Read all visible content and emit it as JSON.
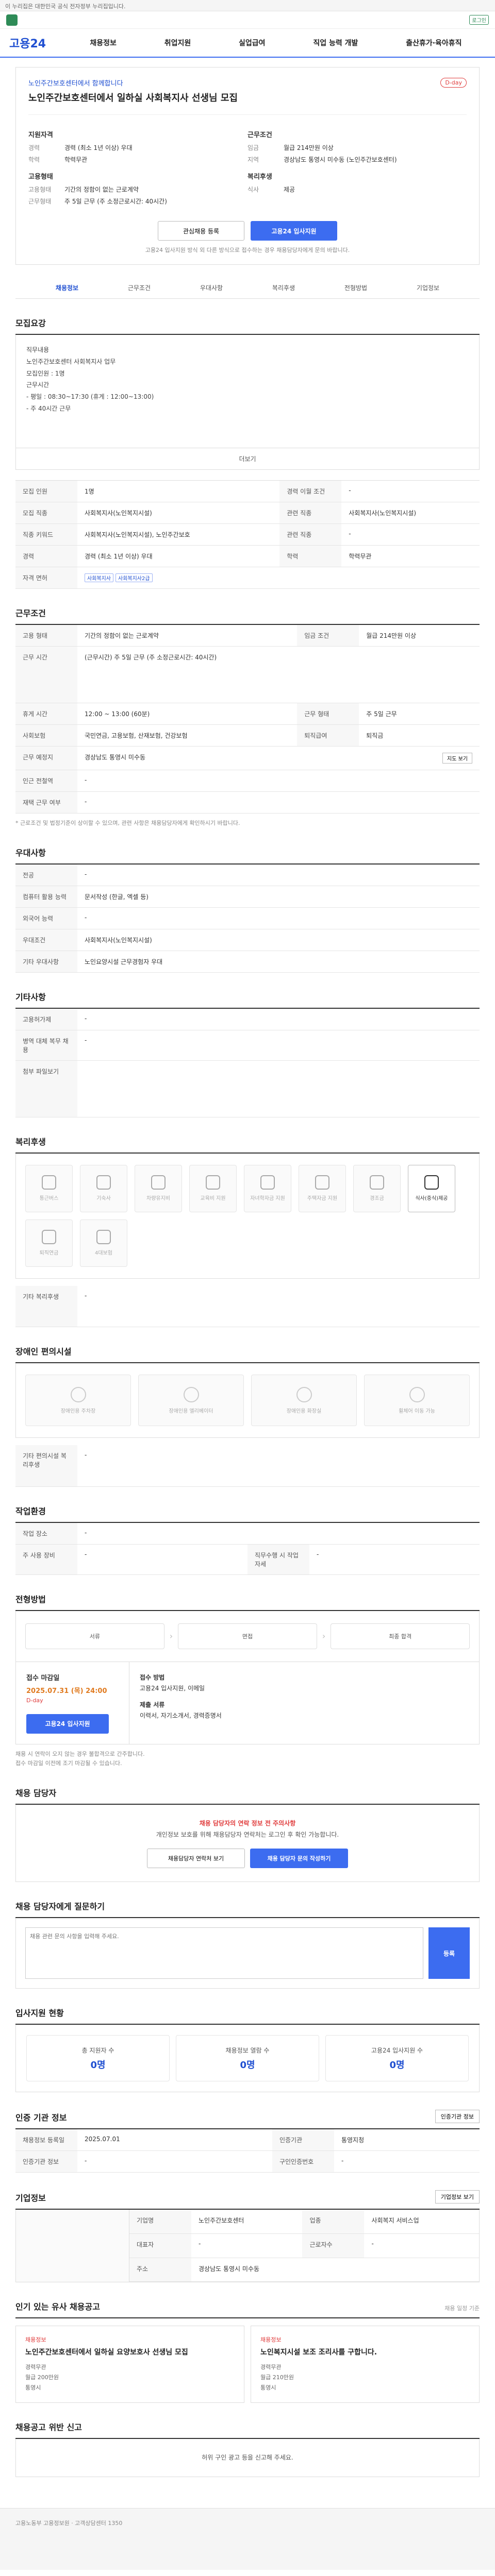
{
  "topbar": {
    "text": "이 누리집은 대한민국 공식 전자정부 누리집입니다."
  },
  "site": {
    "logo": "고용24",
    "badge": "로그인"
  },
  "gnb": [
    "채용정보",
    "취업지원",
    "실업급여",
    "직업 능력 개발",
    "출산휴가·육아휴직"
  ],
  "lnb": [
    "채용정보",
    "근무조건",
    "우대사항",
    "복리후생",
    "전형방법",
    "기업정보"
  ],
  "job": {
    "company": "노인주간보호센터에서 함께합니다",
    "title": "노인주간보호센터에서 일하실 사회복지사 선생님 모집",
    "dday": "D-day",
    "left_head": "지원자격",
    "left_rows": [
      {
        "k": "경력",
        "v": "경력 (최소 1년 이상) 우대"
      },
      {
        "k": "학력",
        "v": "학력무관"
      }
    ],
    "left_head2": "고용형태",
    "left_rows2": [
      {
        "k": "고용형태",
        "v": "기간의 정함이 없는 근로계약"
      },
      {
        "k": "근무형태",
        "v": "주 5일 근무 (주 소정근로시간: 40시간)"
      }
    ],
    "right_head": "근무조건",
    "right_rows": [
      {
        "k": "임금",
        "v": "월급 214만원 이상"
      },
      {
        "k": "지역",
        "v": "경상남도 통영시 미수동 (노인주간보호센터)"
      }
    ],
    "right_head2": "복리후생",
    "right_rows2": [
      {
        "k": "식사",
        "v": "제공"
      }
    ],
    "btn_scrap": "관심채용 등록",
    "btn_apply": "고용24 입사지원",
    "apply_note": "고용24 입사지원 방식 외 다른 방식으로 접수하는 경우 채용담당자에게 문의 바랍니다."
  },
  "recruit": {
    "title": "모집요강",
    "lines": [
      "직무내용",
      "노인주간보호센터 사회복지사 업무",
      "",
      "모집인원 : 1명",
      "",
      "근무시간",
      "- 평일 : 08:30~17:30 (휴게 : 12:00~13:00)",
      "- 주 40시간 근무"
    ],
    "more": "더보기"
  },
  "summary": {
    "rows": [
      {
        "k": "모집 인원",
        "v": "1명",
        "k2": "경력 이월 조건",
        "v2": "-"
      },
      {
        "k": "모집 직종",
        "v": "사회복지사(노인복지시설)",
        "k2": "관련 직종",
        "v2": "사회복지사(노인복지시설)"
      },
      {
        "k": "직종 키워드",
        "v": "사회복지사(노인복지시설), 노인주간보호",
        "k2": "관련 직종",
        "v2": "-"
      },
      {
        "k": "경력",
        "v": "경력 (최소 1년 이상) 우대",
        "k2": "학력",
        "v2": "학력무관"
      }
    ],
    "tags_label": "자격 면허",
    "tags": [
      "사회복지사",
      "사회복지사2급"
    ]
  },
  "conditions": {
    "title": "근무조건",
    "rows": [
      {
        "k": "고용 형태",
        "v": "기간의 정함이 없는 근로계약",
        "k2": "임금 조건",
        "v2": "월급 214만원 이상"
      },
      {
        "k": "근무 시간",
        "v": "(근무시간) 주 5일 근무 (주 소정근로시간: 40시간)",
        "k2": "",
        "v2": ""
      },
      {
        "k": "휴게 시간",
        "v": "12:00 ~ 13:00 (60분)",
        "k2": "근무 형태",
        "v2": "주 5일 근무"
      },
      {
        "k": "사회보험",
        "v": "국민연금, 고용보험, 산재보험, 건강보험",
        "k2": "퇴직급여",
        "v2": "퇴직금"
      },
      {
        "k": "근무 예정지",
        "v": "경상남도 통영시 미수동",
        "k2": "",
        "v2": ""
      },
      {
        "k": "인근 전철역",
        "v": "-",
        "k2": "",
        "v2": ""
      },
      {
        "k": "재택 근무 여부",
        "v": "-",
        "k2": "",
        "v2": ""
      }
    ],
    "map_btn": "지도 보기",
    "note": "* 근로조건 및 법정기준이 상이할 수 있으며, 관련 사항은 채용담당자에게 확인하시기 바랍니다."
  },
  "prefer": {
    "title": "우대사항",
    "rows": [
      {
        "k": "전공",
        "v": "-"
      },
      {
        "k": "컴퓨터 활용 능력",
        "v": "문서작성 (한글, 엑셀 등)"
      },
      {
        "k": "외국어 능력",
        "v": "-"
      },
      {
        "k": "우대조건",
        "v": "사회복지사(노인복지시설)"
      },
      {
        "k": "기타 우대사항",
        "v": "노인요양시설 근무경험자 우대"
      }
    ]
  },
  "etc": {
    "title": "기타사항",
    "rows": [
      {
        "k": "고용허가제",
        "v": "-"
      },
      {
        "k": "병역 대체 복무 채용",
        "v": "-"
      }
    ],
    "file_label": "첨부 파일보기"
  },
  "welfare": {
    "title": "복리후생",
    "items": [
      "통근버스",
      "기숙사",
      "차량유지비",
      "교육비 지원",
      "자녀학자금 지원",
      "주택자금 지원",
      "경조금",
      "식사(중식)제공",
      "퇴직연금",
      "4대보험"
    ],
    "etc_label": "기타 복리후생",
    "etc_value": "-"
  },
  "disabled": {
    "title": "장애인 편의시설",
    "items": [
      "장애인용 주차장",
      "장애인용 엘리베이터",
      "장애인용 화장실",
      "휠체어 이동 가능"
    ],
    "etc_label": "기타 편의시설 복리후생",
    "etc_value": "-"
  },
  "worktype": {
    "title": "작업환경",
    "rows": [
      {
        "k": "작업 장소",
        "v": "-",
        "k2": "",
        "v2": ""
      },
      {
        "k": "주 사용 장비",
        "v": "-",
        "k2": "직무수행 시 작업 자세",
        "v2": "-"
      }
    ]
  },
  "process": {
    "title": "전형방법",
    "steps": [
      "서류",
      "면접",
      "최종 합격"
    ]
  },
  "schedule": {
    "title": "접수 마감일",
    "date": "2025.07.31 (목) 24:00",
    "dday": "D-day",
    "method_title": "접수 방법",
    "method": "고용24 입사지원, 이메일",
    "docs_title": "제출 서류",
    "docs": "이력서, 자기소개서, 경력증명서",
    "apply_btn": "고용24 입사지원",
    "notes": [
      "채용 시 연락이 오지 않는 경우 불합격으로 간주합니다.",
      "접수 마감일 이전에 조기 마감될 수 있습니다."
    ]
  },
  "contact": {
    "title": "채용 담당자",
    "warn": "채용 담당자의 연락 정보 전 주의사항",
    "desc": "개인정보 보호를 위해 채용담당자 연락처는 로그인 후 확인 가능합니다.",
    "btn1": "채용담당자 연락처 보기",
    "btn2": "채용 담당자 문의 작성하기"
  },
  "qa": {
    "title": "채용 담당자에게 질문하기",
    "placeholder": "채용 관련 문의 사항을 입력해 주세요.",
    "btn": "등록"
  },
  "stats": {
    "title": "입사지원 현황",
    "cards": [
      {
        "k": "총 지원자 수",
        "v": "0명"
      },
      {
        "k": "채용정보 열람 수",
        "v": "0명"
      },
      {
        "k": "고용24 입사지원 수",
        "v": "0명"
      }
    ]
  },
  "info": {
    "title": "인증 기관 정보",
    "rows": [
      {
        "k": "채용정보 등록일",
        "v": "2025.07.01",
        "k2": "인증기관",
        "v2": "통영지청"
      },
      {
        "k": "인증기관 정보",
        "v": "-",
        "k2": "구인인증번호",
        "v2": "-"
      }
    ],
    "btn": "인증기관 정보"
  },
  "company": {
    "title": "기업정보",
    "rows": [
      {
        "k": "기업명",
        "v": "노인주간보호센터",
        "k2": "업종",
        "v2": "사회복지 서비스업"
      },
      {
        "k": "대표자",
        "v": "-",
        "k2": "근로자수",
        "v2": "-"
      },
      {
        "k": "주소",
        "v": "경상남도 통영시 미수동",
        "k2": "",
        "v2": ""
      }
    ],
    "btn": "기업정보 보기"
  },
  "others": {
    "title": "인기 있는 유사 채용공고",
    "sub": "채용 일정 기준",
    "cards": [
      {
        "co": "채용정보",
        "ti": "노인주간보호센터에서 일하실 요양보호사 선생님 모집",
        "lines": [
          "경력무관",
          "월급 200만원",
          "통영시"
        ]
      },
      {
        "co": "채용정보",
        "ti": "노인복지시설 보조 조리사를 구합니다.",
        "lines": [
          "경력무관",
          "월급 210만원",
          "통영시"
        ]
      }
    ]
  },
  "help": {
    "title": "채용공고 위반 신고",
    "desc": "허위 구인 광고 등을 신고해 주세요."
  },
  "footer": {
    "text": "고용노동부 고용정보원 · 고객상담센터 1350"
  },
  "colors": {
    "brand": "#1f4fd1",
    "accent": "#3c6cf0",
    "warn": "#e03c3c"
  }
}
